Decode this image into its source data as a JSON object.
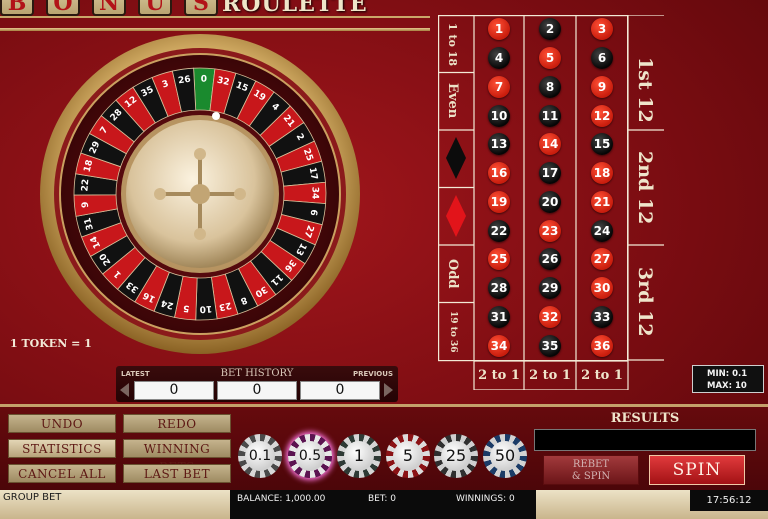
{
  "title": {
    "tiles": [
      "B",
      "O",
      "N",
      "U",
      "S"
    ],
    "text": "ROULETTE"
  },
  "wheel": {
    "numbers": [
      "0",
      "32",
      "15",
      "19",
      "4",
      "21",
      "2",
      "25",
      "17",
      "34",
      "6",
      "27",
      "13",
      "36",
      "11",
      "30",
      "8",
      "23",
      "10",
      "5",
      "24",
      "16",
      "33",
      "1",
      "20",
      "14",
      "31",
      "9",
      "22",
      "18",
      "29",
      "7",
      "28",
      "12",
      "35",
      "3",
      "26"
    ],
    "token_label": "1 TOKEN = 1"
  },
  "table": {
    "rows": [
      [
        {
          "n": "1",
          "c": "red"
        },
        {
          "n": "2",
          "c": "black"
        },
        {
          "n": "3",
          "c": "red"
        }
      ],
      [
        {
          "n": "4",
          "c": "black"
        },
        {
          "n": "5",
          "c": "red"
        },
        {
          "n": "6",
          "c": "black"
        }
      ],
      [
        {
          "n": "7",
          "c": "red"
        },
        {
          "n": "8",
          "c": "black"
        },
        {
          "n": "9",
          "c": "red"
        }
      ],
      [
        {
          "n": "10",
          "c": "black"
        },
        {
          "n": "11",
          "c": "black"
        },
        {
          "n": "12",
          "c": "red"
        }
      ],
      [
        {
          "n": "13",
          "c": "black"
        },
        {
          "n": "14",
          "c": "red"
        },
        {
          "n": "15",
          "c": "black"
        }
      ],
      [
        {
          "n": "16",
          "c": "red"
        },
        {
          "n": "17",
          "c": "black"
        },
        {
          "n": "18",
          "c": "red"
        }
      ],
      [
        {
          "n": "19",
          "c": "red"
        },
        {
          "n": "20",
          "c": "black"
        },
        {
          "n": "21",
          "c": "red"
        }
      ],
      [
        {
          "n": "22",
          "c": "black"
        },
        {
          "n": "23",
          "c": "red"
        },
        {
          "n": "24",
          "c": "black"
        }
      ],
      [
        {
          "n": "25",
          "c": "red"
        },
        {
          "n": "26",
          "c": "black"
        },
        {
          "n": "27",
          "c": "red"
        }
      ],
      [
        {
          "n": "28",
          "c": "black"
        },
        {
          "n": "29",
          "c": "black"
        },
        {
          "n": "30",
          "c": "red"
        }
      ],
      [
        {
          "n": "31",
          "c": "black"
        },
        {
          "n": "32",
          "c": "red"
        },
        {
          "n": "33",
          "c": "black"
        }
      ],
      [
        {
          "n": "34",
          "c": "red"
        },
        {
          "n": "35",
          "c": "black"
        },
        {
          "n": "36",
          "c": "red"
        }
      ]
    ],
    "outside": {
      "low": "1 to 18",
      "even": "Even",
      "odd": "Odd",
      "high": "19 to 36"
    },
    "dozens": [
      "1st 12",
      "2nd 12",
      "3rd 12"
    ],
    "columns": [
      "2 to 1",
      "2 to 1",
      "2 to 1"
    ]
  },
  "limits": {
    "min": "MIN: 0.1",
    "max": "MAX: 10"
  },
  "history": {
    "title": "BET HISTORY",
    "latest": "LATEST",
    "previous": "PREVIOUS",
    "values": [
      "0",
      "0",
      "0"
    ]
  },
  "controls": {
    "undo": "UNDO",
    "redo": "REDO",
    "statistics": "STATISTICS",
    "winning_bets": "WINNING BETS",
    "cancel_all": "CANCEL ALL",
    "last_bet": "LAST BET"
  },
  "chips": [
    "0.1",
    "0.5",
    "1",
    "5",
    "25",
    "50"
  ],
  "results_label": "RESULTS",
  "rebet_line1": "REBET",
  "rebet_line2": "& SPIN",
  "spin": "SPIN",
  "status": {
    "group_bet": "GROUP BET",
    "balance": "BALANCE: 1,000.00",
    "bet": "BET: 0",
    "winnings": "WINNINGS: 0",
    "clock": "17:56:12"
  },
  "colors": {
    "felt": "#7c0d12",
    "gold": "#d9b36a",
    "red_pocket": "#c8171b",
    "black_pocket": "#111111",
    "green_pocket": "#1a8a2e"
  }
}
